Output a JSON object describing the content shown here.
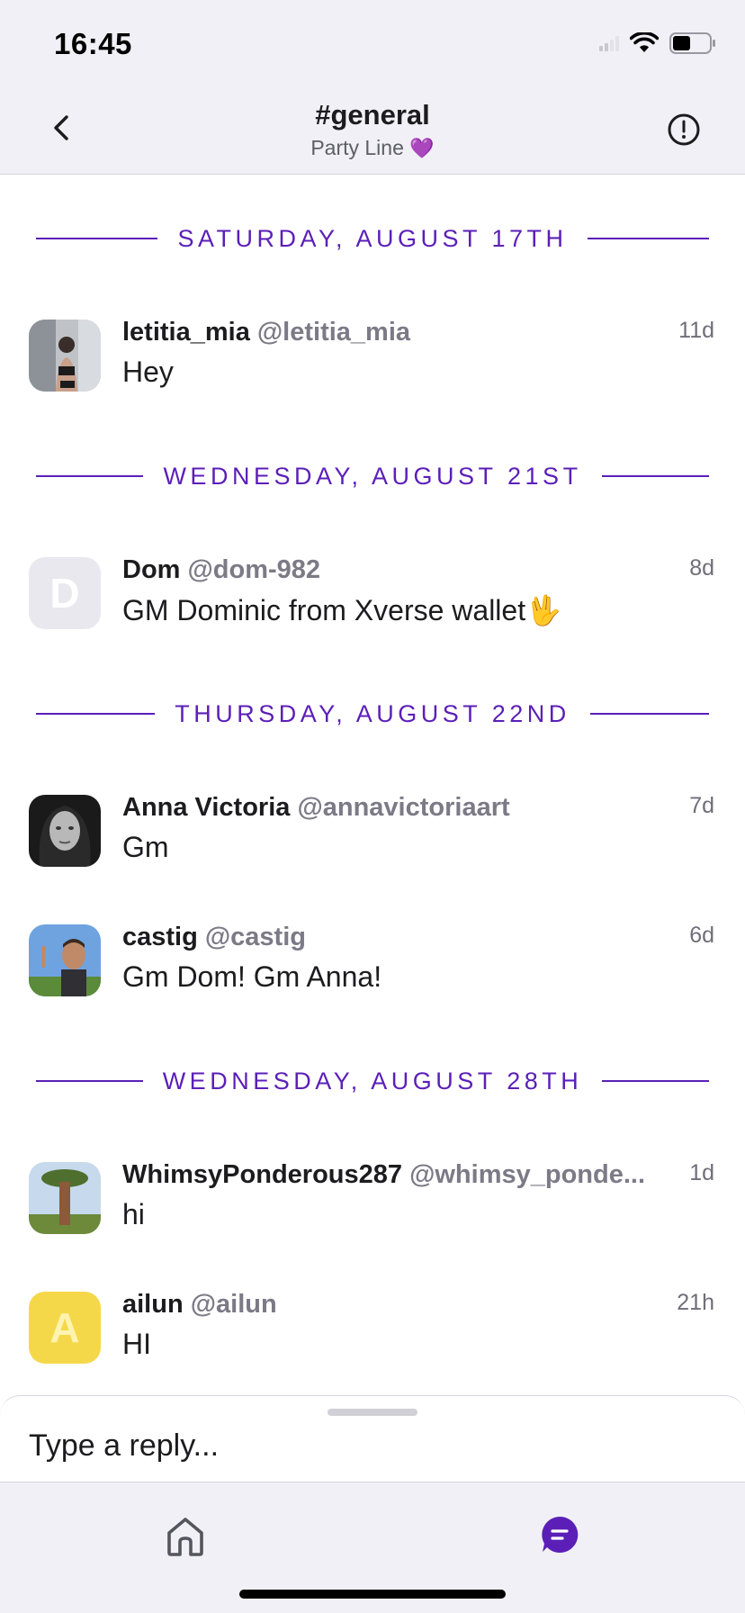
{
  "status_bar": {
    "time": "16:45"
  },
  "header": {
    "title": "#general",
    "subtitle": "Party Line",
    "subtitle_emoji": "💜"
  },
  "feed": {
    "dividers": [
      "SATURDAY, AUGUST 17TH",
      "WEDNESDAY, AUGUST 21ST",
      "THURSDAY, AUGUST 22ND",
      "WEDNESDAY, AUGUST 28TH"
    ],
    "messages": [
      {
        "name": "letitia_mia",
        "handle": "@letitia_mia",
        "time": "11d",
        "text": "Hey",
        "avatar": "photo"
      },
      {
        "name": "Dom",
        "handle": "@dom-982",
        "time": "8d",
        "text": "GM Dominic from Xverse wallet🖖",
        "avatar_letter": "D",
        "avatar_color": "#e8e8ee"
      },
      {
        "name": "Anna Victoria",
        "handle": "@annavictoriaart",
        "time": "7d",
        "text": "Gm",
        "avatar": "photo"
      },
      {
        "name": "castig",
        "handle": "@castig",
        "time": "6d",
        "text": "Gm Dom! Gm Anna!",
        "avatar": "photo"
      },
      {
        "name": "WhimsyPonderous287",
        "handle": "@whimsy_ponde...",
        "time": "1d",
        "text": "hi",
        "avatar": "photo"
      },
      {
        "name": "ailun",
        "handle": "@ailun",
        "time": "21h",
        "text": "HI",
        "avatar_letter": "A",
        "avatar_color": "#f5d84a"
      }
    ]
  },
  "composer": {
    "placeholder": "Type a reply..."
  },
  "colors": {
    "accent": "#5b1fb8",
    "background": "#f1f0f6"
  }
}
